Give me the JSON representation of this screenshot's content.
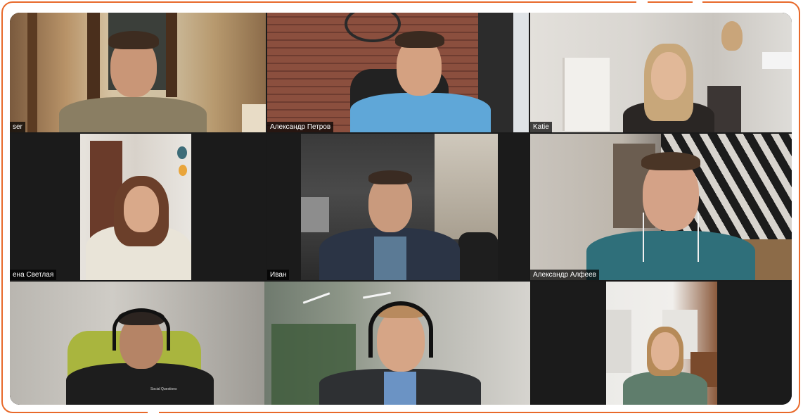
{
  "meeting": {
    "participants": [
      {
        "name": "ser",
        "position": "top-left"
      },
      {
        "name": "Александр Петров",
        "position": "top-center"
      },
      {
        "name": "Katie",
        "position": "top-right"
      },
      {
        "name": "ена Светлая",
        "position": "middle-left"
      },
      {
        "name": "Иван",
        "position": "middle-center"
      },
      {
        "name": "Александр Алфеев",
        "position": "middle-right"
      },
      {
        "name": "",
        "position": "bottom-left"
      },
      {
        "name": "",
        "position": "bottom-center"
      },
      {
        "name": "",
        "position": "bottom-right"
      }
    ],
    "shirt_text": "Social Questions"
  },
  "colors": {
    "frame_accent": "#e8692a",
    "grid_background": "#1a1a1a",
    "name_tag_background": "#000000",
    "name_tag_text": "#ffffff"
  }
}
